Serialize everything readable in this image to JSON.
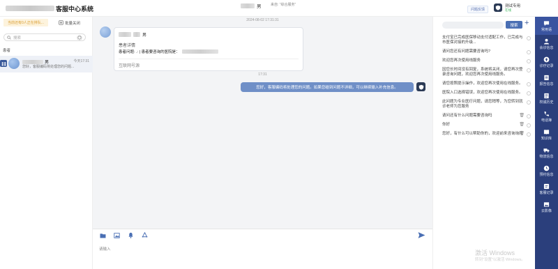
{
  "app": {
    "title": "客服中心系统"
  },
  "header": {
    "chat_user_suffix": "男",
    "chat_source": "来自: “综合服务”",
    "feedback_btn": "问题反馈",
    "agent_name": "测试专用",
    "agent_status": "在线"
  },
  "left": {
    "queue_tag": "当前还有0人正在排队...",
    "batch_close": "批量关闭",
    "search_placeholder": "搜索",
    "section_label": "患者",
    "conversation": {
      "name_suffix": "男",
      "time": "今天17:31",
      "preview": "您好，客服编码将处理您的问题..."
    }
  },
  "chat": {
    "timestamp1": "2024-08-02 17:31:31",
    "card_title_suffix": "男",
    "card_subtitle": "患者详情",
    "card_line": "患者问题: .: | 患者要咨询的医院是：",
    "card_footer": "互联网号源",
    "timestamp2": "17:31",
    "outgoing_message": "您好，客服编码将处理您的问题。如果您碰到问题不详细，可以继续输入补充信息。"
  },
  "compose": {
    "placeholder": "请输入"
  },
  "quick_replies": {
    "search_btn": "搜索",
    "items": [
      {
        "text": "支付宝已完成医保移动支付适配工作，已完成与市医保对接的升级...",
        "trash": false
      },
      {
        "text": "请问您还有问题需要咨询吗?",
        "trash": false
      },
      {
        "text": "欢迎您再次使用线服务",
        "trash": false
      },
      {
        "text": "因您长时间没有回复，系统将关闭，请您再次登录咨询问题，欢迎您再次使用线服务。",
        "trash": false
      },
      {
        "text": "请您按照提示操作，欢迎您再次使用在线服务。",
        "trash": false
      },
      {
        "text": "医院入口选择错误，欢迎您再次使用在线服务。",
        "trash": false
      },
      {
        "text": "此问题为专业医疗问题，请您稍等，为您转到就诊老师为您服务",
        "trash": false
      },
      {
        "text": "请问还有什么问题需要咨询吗",
        "trash": true
      },
      {
        "text": "你好",
        "trash": true
      },
      {
        "text": "您好，有什么可以帮助你的，欢迎前来咨询询问",
        "trash": true
      }
    ],
    "watermark_line1": "激活 Windows",
    "watermark_line2": "转到\"设置\"以激活 Windows。"
  },
  "nav": {
    "items": [
      {
        "label": "常用语",
        "icon": "chat-icon",
        "active": true
      },
      {
        "label": "会诊信息",
        "icon": "person-icon",
        "active": false
      },
      {
        "label": "诊疗记录",
        "icon": "upload-icon",
        "active": false
      },
      {
        "label": "报告信息",
        "icon": "report-icon",
        "active": false
      },
      {
        "label": "权诚历史",
        "icon": "document-icon",
        "active": false
      },
      {
        "label": "电话簿",
        "icon": "phone-icon",
        "active": false
      },
      {
        "label": "知识库",
        "icon": "book-icon",
        "active": false
      },
      {
        "label": "物流信息",
        "icon": "truck-icon",
        "active": false
      },
      {
        "label": "预约信息",
        "icon": "clock-icon",
        "active": false
      },
      {
        "label": "客服记录",
        "icon": "record-icon",
        "active": false
      },
      {
        "label": "云影像",
        "icon": "image-icon",
        "active": false
      }
    ]
  },
  "colors": {
    "accent": "#4a6fb4",
    "nav_bg": "#2b3f7c",
    "bubble": "#6f8fc7",
    "queue_bg": "#fdf3dd"
  }
}
